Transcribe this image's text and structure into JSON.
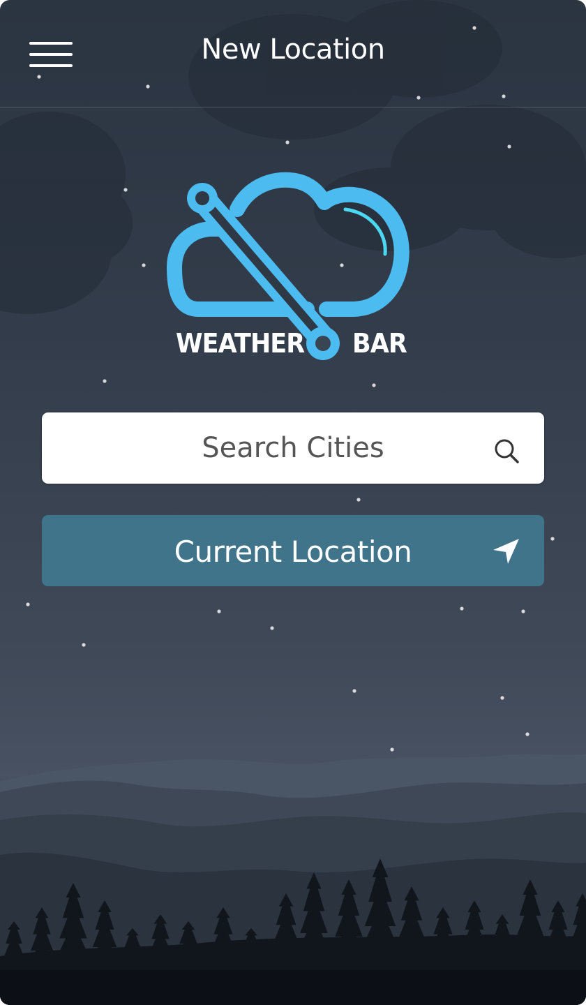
{
  "header": {
    "title": "New Location",
    "menu_icon": "hamburger-menu-icon"
  },
  "logo": {
    "word_left": "WEATHER",
    "word_right": "BAR",
    "icon": "weather-bar-cloud-logo"
  },
  "search": {
    "placeholder": "Search Cities",
    "value": "",
    "icon": "search-icon"
  },
  "current_location": {
    "label": "Current Location",
    "icon": "navigation-arrow-icon"
  },
  "colors": {
    "accent": "#4cbcf0",
    "button": "#3f748a",
    "background_top": "#2b3441",
    "background_mid": "#485262"
  }
}
